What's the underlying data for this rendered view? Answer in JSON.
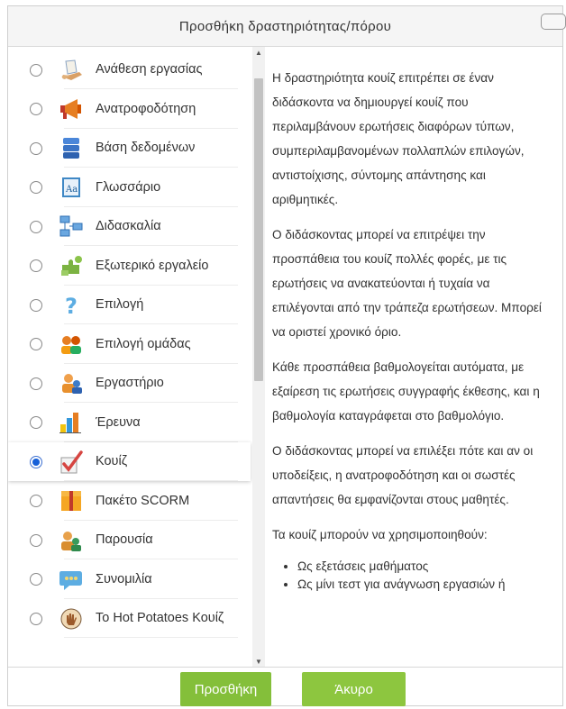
{
  "dialog": {
    "title": "Προσθήκη δραστηριότητας/πόρου"
  },
  "activities": [
    {
      "label": "Ανάθεση εργασίας",
      "icon": "assignment-icon",
      "selected": false
    },
    {
      "label": "Ανατροφοδότηση",
      "icon": "megaphone-icon",
      "selected": false
    },
    {
      "label": "Βάση δεδομένων",
      "icon": "database-icon",
      "selected": false
    },
    {
      "label": "Γλωσσάριο",
      "icon": "glossary-icon",
      "selected": false
    },
    {
      "label": "Διδασκαλία",
      "icon": "lesson-icon",
      "selected": false
    },
    {
      "label": "Εξωτερικό εργαλείο",
      "icon": "puzzle-icon",
      "selected": false
    },
    {
      "label": "Επιλογή",
      "icon": "question-mark-icon",
      "selected": false
    },
    {
      "label": "Επιλογή ομάδας",
      "icon": "group-icon",
      "selected": false
    },
    {
      "label": "Εργαστήριο",
      "icon": "workshop-icon",
      "selected": false
    },
    {
      "label": "Έρευνα",
      "icon": "bar-chart-icon",
      "selected": false
    },
    {
      "label": "Κουίζ",
      "icon": "checkmark-icon",
      "selected": true
    },
    {
      "label": "Πακέτο SCORM",
      "icon": "package-icon",
      "selected": false
    },
    {
      "label": "Παρουσία",
      "icon": "attendance-icon",
      "selected": false
    },
    {
      "label": "Συνομιλία",
      "icon": "chat-bubble-icon",
      "selected": false
    },
    {
      "label": "Το Hot Potatoes Κουίζ",
      "icon": "hand-icon",
      "selected": false
    }
  ],
  "description": {
    "paragraphs": [
      "Η δραστηριότητα κουίζ επιτρέπει σε έναν διδάσκοντα να δημιουργεί κουίζ που περιλαμβάνουν ερωτήσεις διαφόρων τύπων, συμπεριλαμβανομένων πολλαπλών επιλογών, αντιστοίχισης, σύντομης απάντησης και αριθμητικές.",
      "Ο διδάσκοντας μπορεί να επιτρέψει την προσπάθεια του κουίζ πολλές φορές, με τις ερωτήσεις να ανακατεύονται ή τυχαία να επιλέγονται από την τράπεζα ερωτήσεων. Μπορεί να οριστεί χρονικό όριο.",
      "Κάθε προσπάθεια βαθμολογείται αυτόματα, με εξαίρεση τις ερωτήσεις συγγραφής έκθεσης, και η βαθμολογία καταγράφεται στο βαθμολόγιο.",
      "Ο διδάσκοντας μπορεί να επιλέξει πότε και αν οι υποδείξεις, η ανατροφοδότηση και οι σωστές απαντήσεις θα εμφανίζονται στους μαθητές.",
      "Τα κουίζ μπορούν να χρησιμοποιηθούν:"
    ],
    "bullets": [
      "Ως εξετάσεις μαθήματος",
      "Ως μίνι τεστ για ανάγνωση εργασιών ή"
    ]
  },
  "footer": {
    "add_label": "Προσθήκη",
    "cancel_label": "Άκυρο"
  },
  "colors": {
    "accent_green": "#8dc63f",
    "radio_selected": "#1660d8"
  }
}
